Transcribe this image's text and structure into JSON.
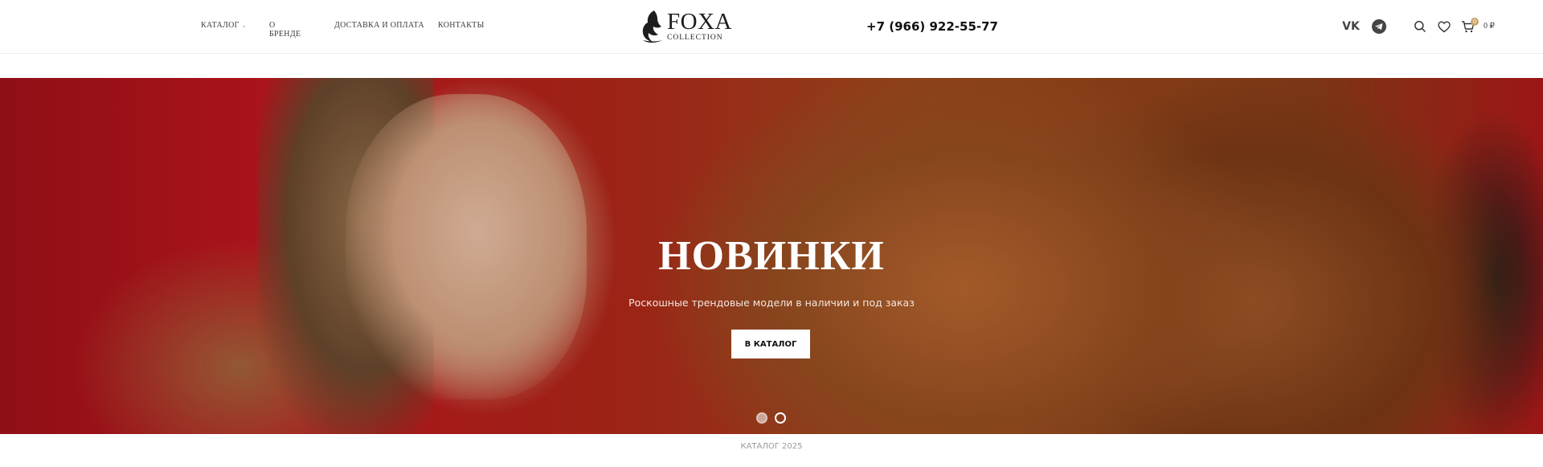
{
  "header": {
    "nav": [
      {
        "label": "КАТАЛОГ",
        "has_dropdown": true
      },
      {
        "label": "О БРЕНДЕ"
      },
      {
        "label": "ДОСТАВКА И ОПЛАТА"
      },
      {
        "label": "КОНТАКТЫ"
      }
    ],
    "logo": {
      "name": "FOXA",
      "sub": "COLLECTION"
    },
    "phone": "+7 (966) 922-55-77",
    "social": {
      "vk": "VK",
      "telegram": "telegram-icon"
    },
    "cart": {
      "count": "0",
      "total": "0 ₽"
    }
  },
  "hero": {
    "title": "НОВИНКИ",
    "subtitle": "Роскошные трендовые модели в наличии и под заказ",
    "button_label": "В КАТАЛОГ",
    "slides_count": 2,
    "active_slide": 2
  },
  "footer_link": "КАТАЛОГ 2025",
  "colors": {
    "accent": "#c9a56a",
    "hero_red": "#c4161f",
    "text": "#3a3a3a"
  }
}
